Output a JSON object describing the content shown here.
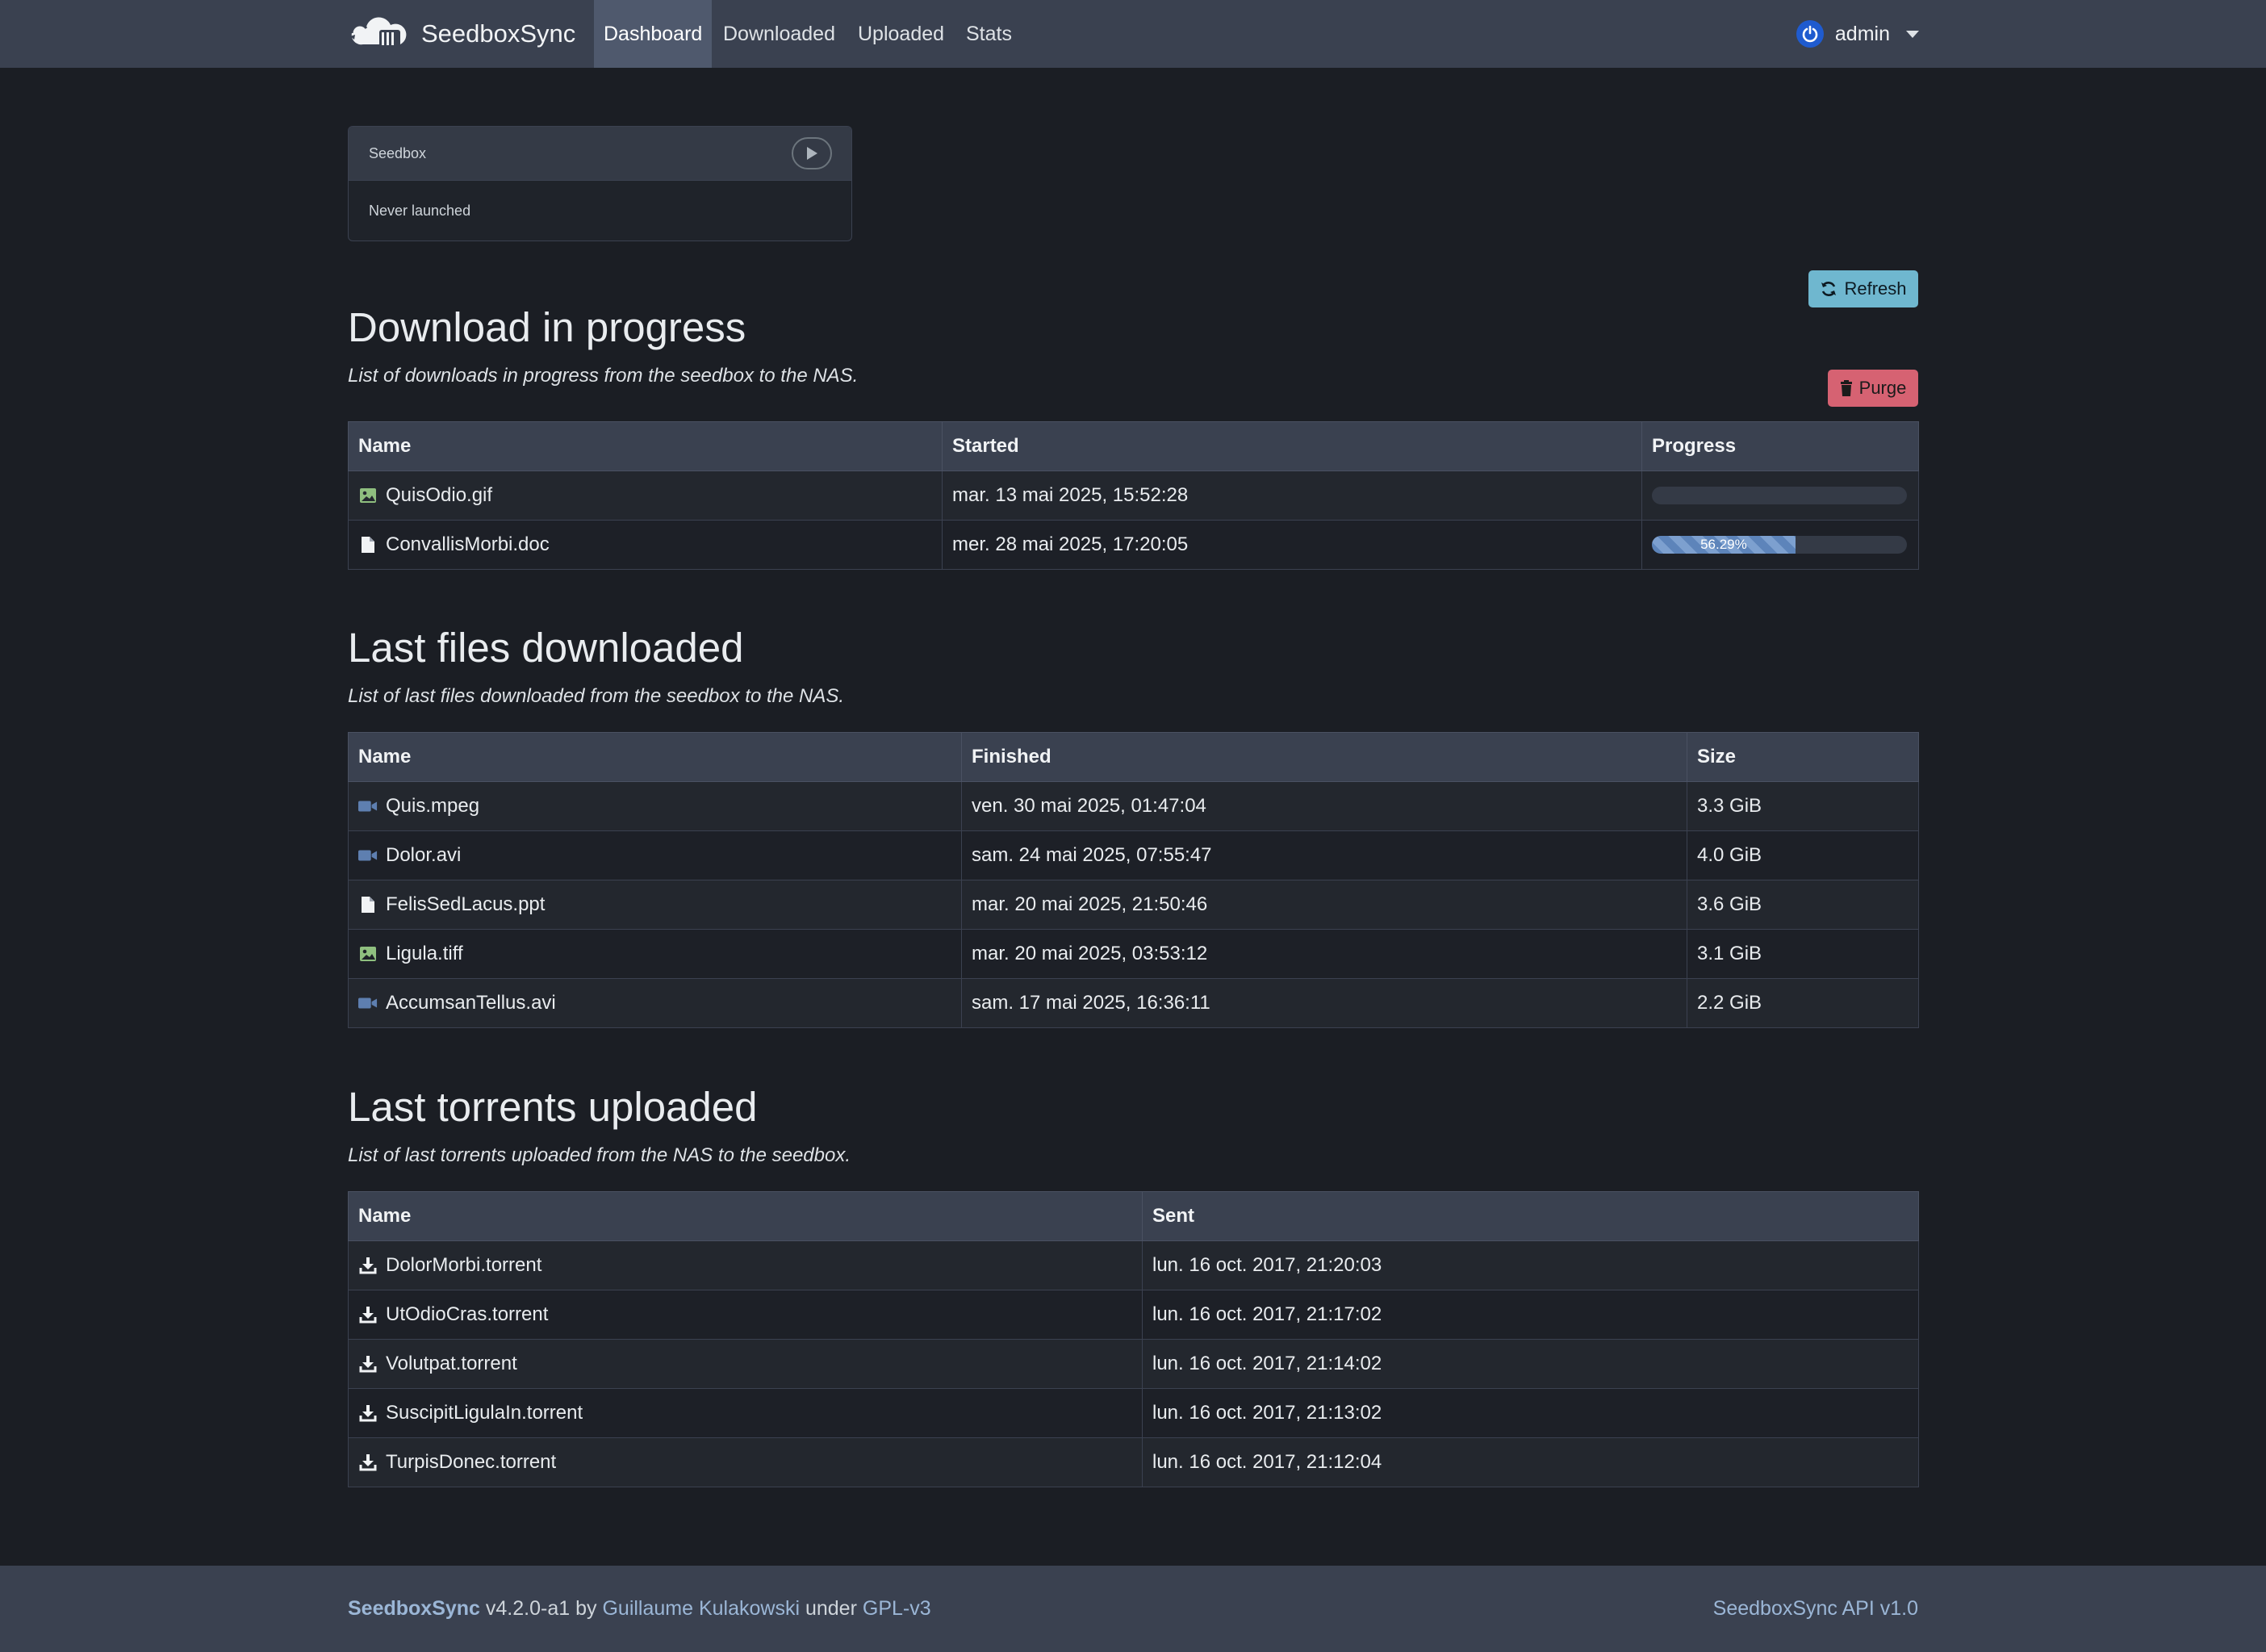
{
  "navbar": {
    "brand": "SeedboxSync",
    "links": [
      {
        "label": "Dashboard",
        "active": true
      },
      {
        "label": "Downloaded",
        "active": false
      },
      {
        "label": "Uploaded",
        "active": false
      },
      {
        "label": "Stats",
        "active": false
      }
    ],
    "user": {
      "name": "admin",
      "icon": "power-icon"
    }
  },
  "seedbox_card": {
    "title": "Seedbox",
    "status": "Never launched",
    "action_icon": "play-icon"
  },
  "buttons": {
    "refresh": {
      "label": "Refresh",
      "icon": "sync-icon",
      "color": "#6fb7cf"
    },
    "purge": {
      "label": "Purge",
      "icon": "trash-icon",
      "color": "#d66272"
    }
  },
  "downloads_in_progress": {
    "title": "Download in progress",
    "subtitle": "List of downloads in progress from the seedbox to the NAS.",
    "columns": [
      "Name",
      "Started",
      "Progress"
    ],
    "rows": [
      {
        "icon": "image-file-icon",
        "name": "QuisOdio.gif",
        "started": "mar. 13 mai 2025, 15:52:28",
        "progress": 0,
        "progress_label": ""
      },
      {
        "icon": "file-icon",
        "name": "ConvallisMorbi.doc",
        "started": "mer. 28 mai 2025, 17:20:05",
        "progress": 56.29,
        "progress_label": "56.29%"
      }
    ]
  },
  "last_downloaded": {
    "title": "Last files downloaded",
    "subtitle": "List of last files downloaded from the seedbox to the NAS.",
    "columns": [
      "Name",
      "Finished",
      "Size"
    ],
    "rows": [
      {
        "icon": "video-file-icon",
        "name": "Quis.mpeg",
        "finished": "ven. 30 mai 2025, 01:47:04",
        "size": "3.3 GiB"
      },
      {
        "icon": "video-file-icon",
        "name": "Dolor.avi",
        "finished": "sam. 24 mai 2025, 07:55:47",
        "size": "4.0 GiB"
      },
      {
        "icon": "file-icon",
        "name": "FelisSedLacus.ppt",
        "finished": "mar. 20 mai 2025, 21:50:46",
        "size": "3.6 GiB"
      },
      {
        "icon": "image-file-icon",
        "name": "Ligula.tiff",
        "finished": "mar. 20 mai 2025, 03:53:12",
        "size": "3.1 GiB"
      },
      {
        "icon": "video-file-icon",
        "name": "AccumsanTellus.avi",
        "finished": "sam. 17 mai 2025, 16:36:11",
        "size": "2.2 GiB"
      }
    ]
  },
  "last_uploaded": {
    "title": "Last torrents uploaded",
    "subtitle": "List of last torrents uploaded from the NAS to the seedbox.",
    "columns": [
      "Name",
      "Sent"
    ],
    "rows": [
      {
        "icon": "download-icon",
        "name": "DolorMorbi.torrent",
        "sent": "lun. 16 oct. 2017, 21:20:03"
      },
      {
        "icon": "download-icon",
        "name": "UtOdioCras.torrent",
        "sent": "lun. 16 oct. 2017, 21:17:02"
      },
      {
        "icon": "download-icon",
        "name": "Volutpat.torrent",
        "sent": "lun. 16 oct. 2017, 21:14:02"
      },
      {
        "icon": "download-icon",
        "name": "SuscipitLigulaIn.torrent",
        "sent": "lun. 16 oct. 2017, 21:13:02"
      },
      {
        "icon": "download-icon",
        "name": "TurpisDonec.torrent",
        "sent": "lun. 16 oct. 2017, 21:12:04"
      }
    ]
  },
  "footer": {
    "app": "SeedboxSync",
    "version": "v4.2.0-a1",
    "by": "by",
    "author": "Guillaume Kulakowski",
    "under": "under",
    "license": "GPL-v3",
    "api": "SeedboxSync API v1.0"
  },
  "colors": {
    "navbar": "#3a4150",
    "background": "#1b1e24",
    "link": "#9bb6d6",
    "progress": "#5d84ba"
  }
}
